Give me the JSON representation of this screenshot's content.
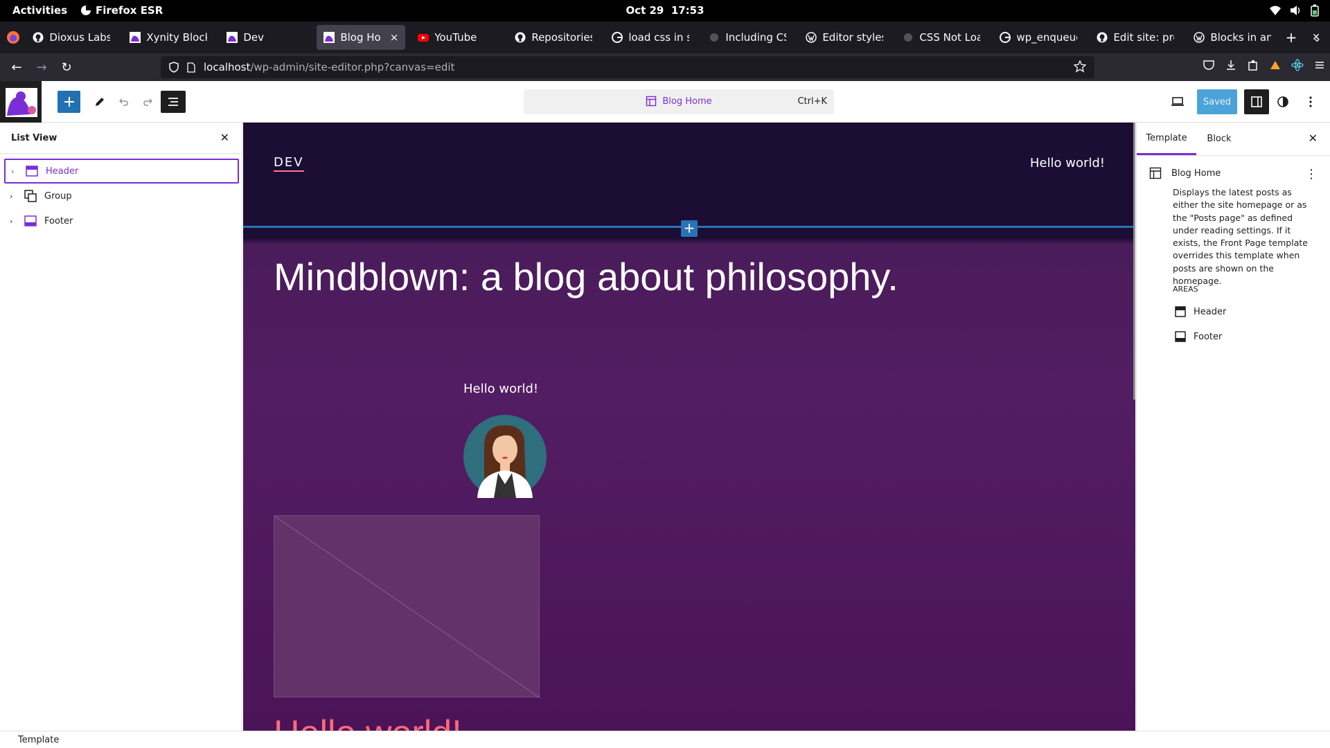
{
  "system": {
    "activities": "Activities",
    "app_name": "Firefox ESR",
    "date": "Oct 29",
    "time": "17:53"
  },
  "tabs": [
    {
      "label": "Dioxus Labs",
      "icon": "github-icon",
      "width": 132
    },
    {
      "label": "Xynity Blocks",
      "icon": "wp-site-icon",
      "width": 132
    },
    {
      "label": "Dev",
      "icon": "wp-site-icon",
      "width": 132
    },
    {
      "label": "Blog Home",
      "icon": "wp-site-icon",
      "width": 128,
      "active": true,
      "close": "×"
    },
    {
      "label": "YouTube",
      "icon": "youtube-icon",
      "width": 132
    },
    {
      "label": "Repositories |",
      "icon": "github-icon",
      "width": 132
    },
    {
      "label": "load css in site",
      "icon": "google-icon",
      "width": 132
    },
    {
      "label": "Including CSS",
      "icon": "generic-icon",
      "width": 132
    },
    {
      "label": "Editor styles c",
      "icon": "wordpress-icon",
      "width": 132
    },
    {
      "label": "CSS Not Load",
      "icon": "generic-icon",
      "width": 132
    },
    {
      "label": "wp_enqueue_",
      "icon": "google-icon",
      "width": 132
    },
    {
      "label": "Edit site: prev",
      "icon": "github-icon",
      "width": 132
    },
    {
      "label": "Blocks in an if",
      "icon": "wordpress-icon",
      "width": 132
    }
  ],
  "tab_actions": {
    "new_tab": "+",
    "list_tabs": "⌄",
    "close_window": "✕"
  },
  "url": {
    "host": "localhost",
    "path": "/wp-admin/site-editor.php?canvas=edit"
  },
  "editor": {
    "document_title": "Blog Home",
    "shortcut": "Ctrl+K",
    "saved_label": "Saved"
  },
  "list_view": {
    "title": "List View",
    "items": [
      {
        "label": "Header",
        "icon": "header-icon",
        "selected": true
      },
      {
        "label": "Group",
        "icon": "group-icon",
        "selected": false
      },
      {
        "label": "Footer",
        "icon": "footer-icon",
        "selected": false
      }
    ]
  },
  "canvas": {
    "site_title": "DEV",
    "nav_link": "Hello world!",
    "heading": "Mindblown: a blog about philosophy.",
    "post_title_small": "Hello world!",
    "post_title_large": "Hello world!"
  },
  "sidebar": {
    "tabs": [
      "Template",
      "Block"
    ],
    "template_name": "Blog Home",
    "description": "Displays the latest posts as either the site homepage or as the \"Posts page\" as defined under reading settings. If it exists, the Front Page template overrides this template when posts are shown on the homepage.",
    "areas_heading": "AREAS",
    "areas": [
      "Header",
      "Footer"
    ]
  },
  "footer": {
    "breadcrumb": "Template"
  },
  "colors": {
    "accent": "#7b2dd6",
    "wp_blue": "#2271b1",
    "canvas_dark": "#1b0d33",
    "canvas_purple": "#531d63",
    "post_title": "#ff6b7a"
  }
}
